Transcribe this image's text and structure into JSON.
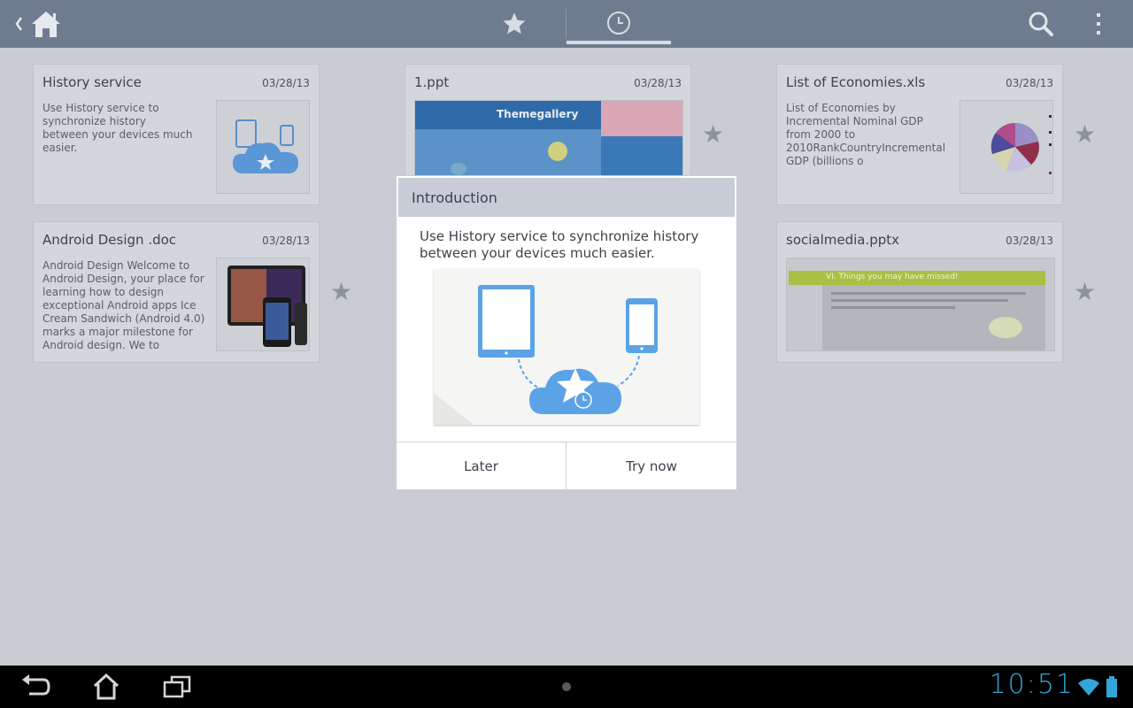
{
  "actionbar": {
    "back_icon": "chevron-left-icon",
    "home_icon": "home-icon",
    "tabs": [
      {
        "name": "favorites",
        "icon": "star-icon",
        "selected": false
      },
      {
        "name": "history",
        "icon": "clock-icon",
        "selected": true
      }
    ],
    "search_icon": "search-icon",
    "overflow_icon": "more-vertical-icon"
  },
  "cards": [
    {
      "title": "History service",
      "date": "03/28/13",
      "desc": "Use History service to synchronize history between your devices much easier."
    },
    {
      "title": "1.ppt",
      "date": "03/28/13",
      "thumb_text": "Themegallery"
    },
    {
      "title": "List of Economies.xls",
      "date": "03/28/13",
      "desc": "List of Economies by Incremental Nominal GDP from 2000 to 2010RankCountryIncremental GDP (billions o"
    },
    {
      "title": "Android Design .doc",
      "date": "03/28/13",
      "desc": "Android Design     Welcome to Android Design, your place for learning how to design exceptional Android apps     Ice Cream Sandwich (Android 4.0) marks a major milestone for Android design. We to"
    },
    {
      "title": "socialmedia.pptx",
      "date": "03/28/13",
      "thumb_text": "VI. Things you may have missed!"
    }
  ],
  "dialog": {
    "title": "Introduction",
    "message": "Use History service to synchronize history between your devices much easier.",
    "later_label": "Later",
    "try_label": "Try now"
  },
  "systembar": {
    "clock": "10:51",
    "accent": "#32a6d8"
  }
}
